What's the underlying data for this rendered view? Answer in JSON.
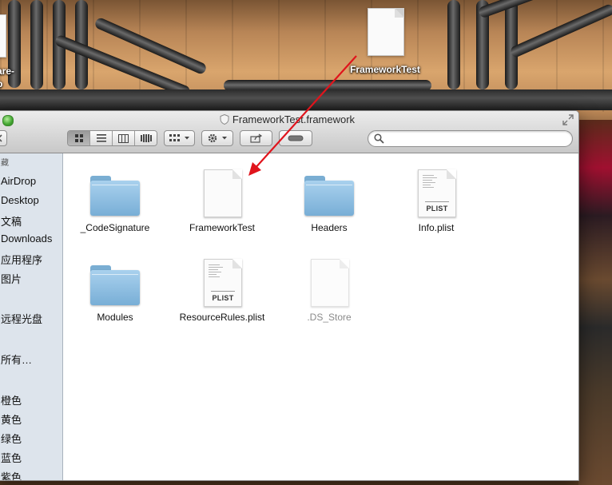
{
  "desktop": {
    "icons": [
      {
        "label": "FrameworkTest"
      },
      {
        "label_line1": "are-",
        "label_line2": "p"
      }
    ]
  },
  "window": {
    "title": "FrameworkTest.framework",
    "search": {
      "placeholder": "",
      "value": ""
    }
  },
  "sidebar": {
    "items": [
      {
        "label": "藏"
      },
      {
        "label": "AirDrop"
      },
      {
        "label": "Desktop"
      },
      {
        "label": "文稿"
      },
      {
        "label": "Downloads"
      },
      {
        "label": "应用程序"
      },
      {
        "label": "图片"
      },
      {
        "label": "远程光盘"
      },
      {
        "label": "所有…"
      },
      {
        "label": "橙色"
      },
      {
        "label": "黄色"
      },
      {
        "label": "绿色"
      },
      {
        "label": "蓝色"
      },
      {
        "label": "紫色"
      }
    ]
  },
  "files": [
    {
      "name": "_CodeSignature",
      "type": "folder"
    },
    {
      "name": "FrameworkTest",
      "type": "document"
    },
    {
      "name": "Headers",
      "type": "folder"
    },
    {
      "name": "Info.plist",
      "type": "plist",
      "badge": "PLIST"
    },
    {
      "name": "Modules",
      "type": "folder"
    },
    {
      "name": "ResourceRules.plist",
      "type": "plist",
      "badge": "PLIST"
    },
    {
      "name": ".DS_Store",
      "type": "document"
    }
  ],
  "colors": {
    "arrow": "#e0141c",
    "sidebar_bg": "#dde4ec",
    "folder_blue": "#8fc0e4"
  }
}
